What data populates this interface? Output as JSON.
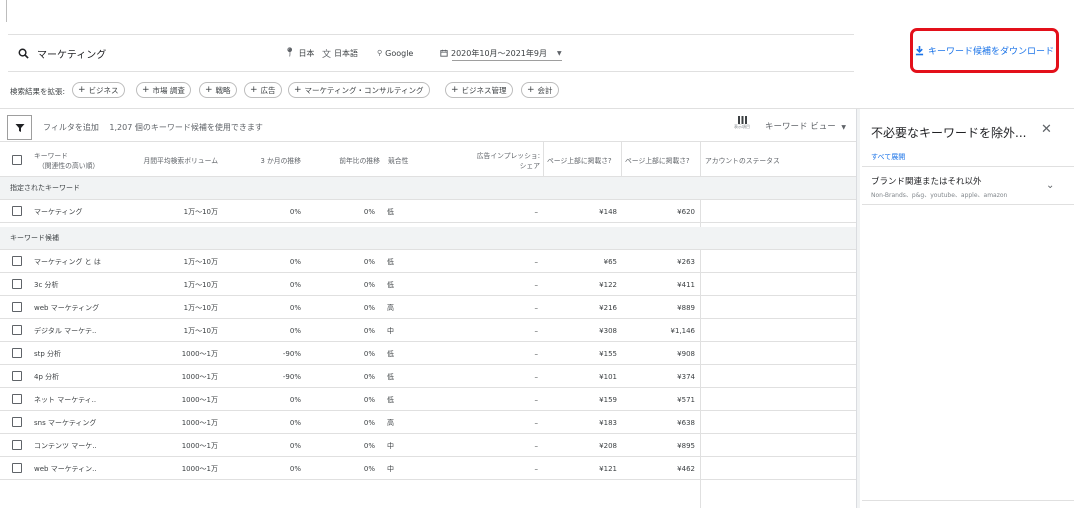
{
  "toolbar": {
    "search_value": "マーケティング",
    "location": "日本",
    "language": "日本語",
    "network": "Google",
    "date_range": "2020年10月～2021年9月",
    "download_label": "キーワード候補をダウンロード"
  },
  "expand": {
    "label": "検索結果を拡張:",
    "chips": [
      "ビジネス",
      "市場 調査",
      "戦略",
      "広告",
      "マーケティング・コンサルティング",
      "ビジネス管理",
      "会計"
    ]
  },
  "filter": {
    "add_label": "フィルタを追加",
    "count_text": "1,207 個のキーワード候補を使用できます",
    "columns_label": "表示項目",
    "view_label": "キーワード ビュー"
  },
  "table": {
    "headers": {
      "keyword_line1": "キーワード",
      "keyword_line2": "（関連性の高い順）",
      "volume": "月間平均検索ボリューム",
      "three_month": "3 か月の推移",
      "yoy": "前年比の推移",
      "competition": "競合性",
      "impression_line1": "広告インプレッショ:",
      "impression_line2": "シェア",
      "top_low": "ページ上部に掲載さ?",
      "top_high": "ページ上部に掲載さ?",
      "account_status": "アカウントのステータス"
    },
    "section_specified": "指定されたキーワード",
    "specified_rows": [
      {
        "keyword": "マーケティング",
        "volume": "1万～10万",
        "three_month": "0%",
        "yoy": "0%",
        "competition": "低",
        "impression": "–",
        "low": "¥148",
        "high": "¥620"
      }
    ],
    "section_ideas": "キーワード候補",
    "idea_rows": [
      {
        "keyword": "マーケティング と は",
        "volume": "1万～10万",
        "three_month": "0%",
        "yoy": "0%",
        "competition": "低",
        "impression": "–",
        "low": "¥65",
        "high": "¥263"
      },
      {
        "keyword": "3c 分析",
        "volume": "1万～10万",
        "three_month": "0%",
        "yoy": "0%",
        "competition": "低",
        "impression": "–",
        "low": "¥122",
        "high": "¥411"
      },
      {
        "keyword": "web マーケティング",
        "volume": "1万～10万",
        "three_month": "0%",
        "yoy": "0%",
        "competition": "高",
        "impression": "–",
        "low": "¥216",
        "high": "¥889"
      },
      {
        "keyword": "デジタル マーケテ..",
        "volume": "1万～10万",
        "three_month": "0%",
        "yoy": "0%",
        "competition": "中",
        "impression": "–",
        "low": "¥308",
        "high": "¥1,146"
      },
      {
        "keyword": "stp 分析",
        "volume": "1000～1万",
        "three_month": "-90%",
        "yoy": "0%",
        "competition": "低",
        "impression": "–",
        "low": "¥155",
        "high": "¥908"
      },
      {
        "keyword": "4p 分析",
        "volume": "1000～1万",
        "three_month": "-90%",
        "yoy": "0%",
        "competition": "低",
        "impression": "–",
        "low": "¥101",
        "high": "¥374"
      },
      {
        "keyword": "ネット マーケティ..",
        "volume": "1000～1万",
        "three_month": "0%",
        "yoy": "0%",
        "competition": "低",
        "impression": "–",
        "low": "¥159",
        "high": "¥571"
      },
      {
        "keyword": "sns マーケティング",
        "volume": "1000～1万",
        "three_month": "0%",
        "yoy": "0%",
        "competition": "高",
        "impression": "–",
        "low": "¥183",
        "high": "¥638"
      },
      {
        "keyword": "コンテンツ マーケ..",
        "volume": "1000～1万",
        "three_month": "0%",
        "yoy": "0%",
        "competition": "中",
        "impression": "–",
        "low": "¥208",
        "high": "¥895"
      },
      {
        "keyword": "web マーケティン..",
        "volume": "1000～1万",
        "three_month": "0%",
        "yoy": "0%",
        "competition": "中",
        "impression": "–",
        "low": "¥121",
        "high": "¥462"
      }
    ]
  },
  "panel": {
    "title": "不必要なキーワードを除外...",
    "expand_all": "すべて展開",
    "item_title": "ブランド関連またはそれ以外",
    "item_sub": "Non-Brands、p&g、youtube、apple、amazon"
  },
  "icons": {
    "search": "search-icon",
    "location": "location-pin-icon",
    "language": "translate-icon",
    "network": "network-icon",
    "calendar": "calendar-icon",
    "download": "download-icon",
    "filter": "filter-icon",
    "columns": "columns-icon",
    "close": "close-icon",
    "chevron": "chevron-down-icon"
  },
  "colors": {
    "accent": "#1a73e8",
    "highlight_box": "#e3101a"
  }
}
